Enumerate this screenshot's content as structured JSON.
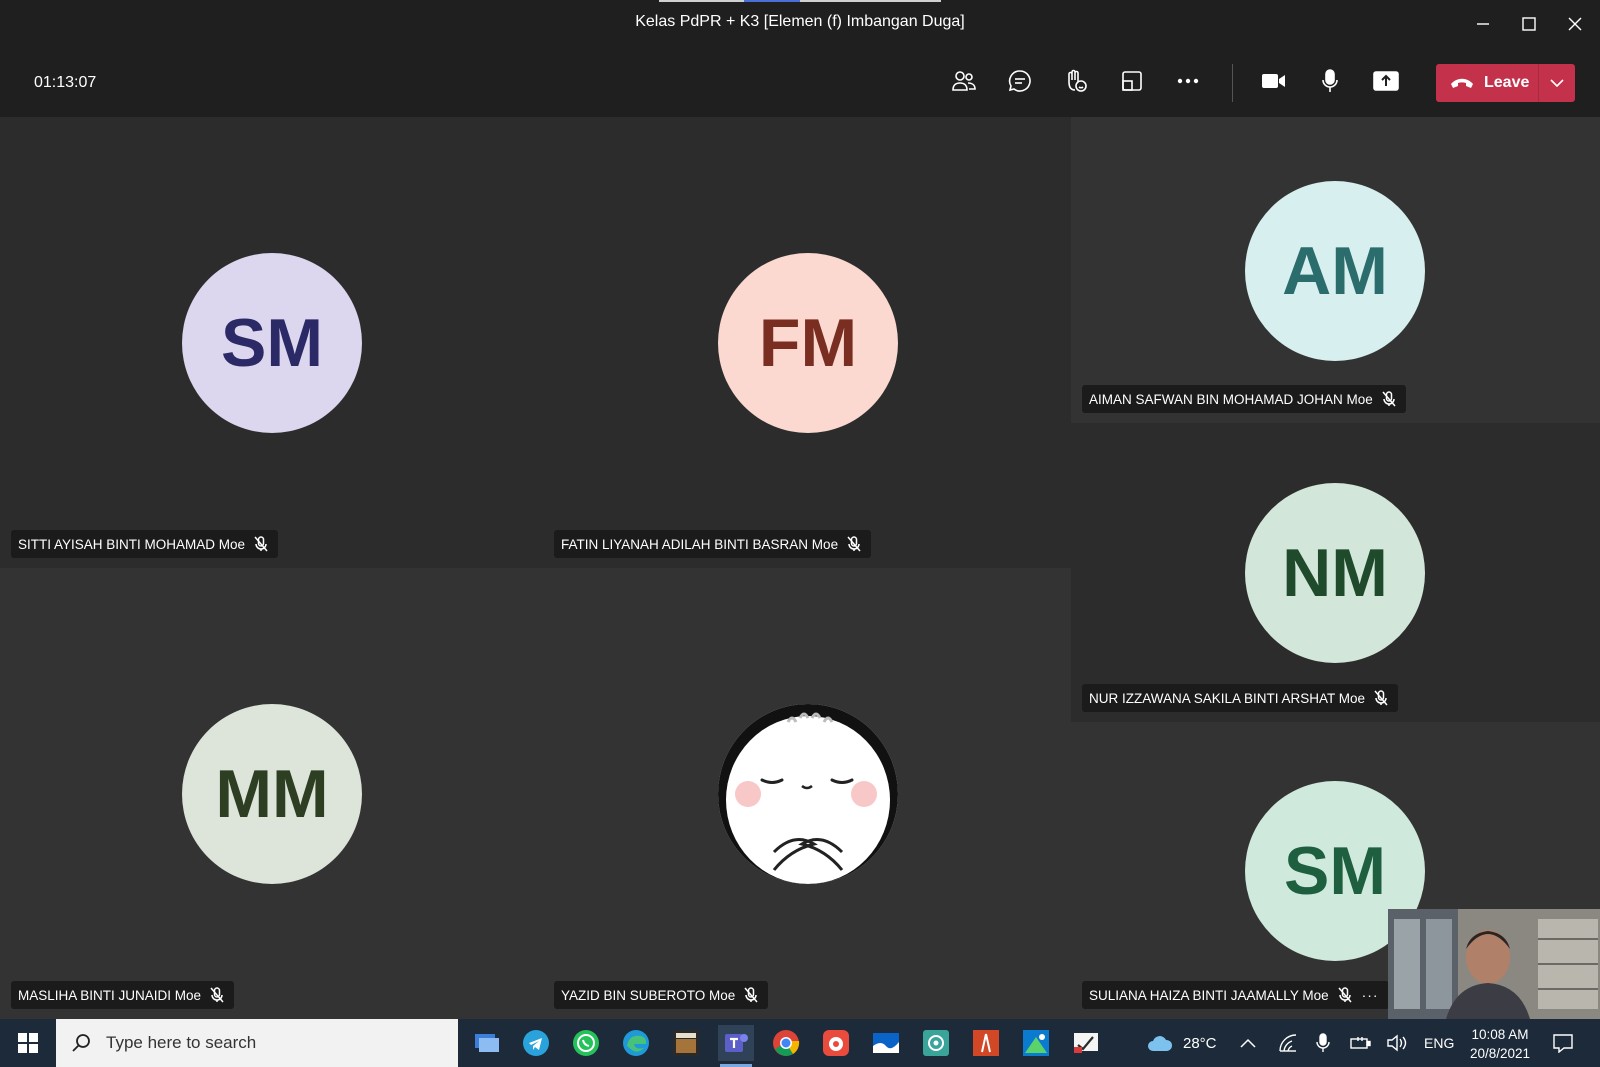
{
  "window": {
    "title": "Kelas PdPR + K3 [Elemen (f) Imbangan Duga]"
  },
  "meeting": {
    "timer": "01:13:07",
    "leave_label": "Leave",
    "toolbar_icons": [
      "people-icon",
      "chat-icon",
      "raise-hand-icon",
      "rooms-icon",
      "more-icon",
      "camera-icon",
      "microphone-icon",
      "share-icon"
    ]
  },
  "participants": [
    {
      "initials": "SM",
      "name": "SITTI AYISAH BINTI MOHAMAD Moe",
      "muted": true,
      "avatar_bg": "#dcd6ee",
      "initials_color": "#2b2a66"
    },
    {
      "initials": "FM",
      "name": "FATIN LIYANAH ADILAH BINTI BASRAN Moe",
      "muted": true,
      "avatar_bg": "#fbd9d1",
      "initials_color": "#7a2e22"
    },
    {
      "initials": "AM",
      "name": "AIMAN SAFWAN BIN MOHAMAD JOHAN Moe",
      "muted": true,
      "avatar_bg": "#d8efef",
      "initials_color": "#2a6d6c"
    },
    {
      "initials": "NM",
      "name": "NUR IZZAWANA SAKILA BINTI ARSHAT Moe",
      "muted": true,
      "avatar_bg": "#d3e6da",
      "initials_color": "#1f4b2c"
    },
    {
      "initials": "MM",
      "name": "MASLIHA BINTI JUNAIDI Moe",
      "muted": true,
      "avatar_bg": "#dde4d9",
      "initials_color": "#2e3e23"
    },
    {
      "initials": "",
      "name": "YAZID BIN SUBEROTO Moe",
      "muted": true,
      "avatar_bg": "#ffffff",
      "initials_color": "#000000",
      "photo": "cartoon-avatar"
    },
    {
      "initials": "SM",
      "name": "SULIANA HAIZA BINTI JAAMALLY Moe",
      "muted": true,
      "avatar_bg": "#cfe9dd",
      "initials_color": "#1e5f40",
      "more": "···"
    }
  ],
  "taskbar": {
    "search_placeholder": "Type here to search",
    "weather": "28°C",
    "language": "ENG",
    "time": "10:08 AM",
    "date": "20/8/2021",
    "apps": [
      "desktop-app-icon",
      "telegram-icon",
      "whatsapp-icon",
      "edge-icon",
      "game-app-icon",
      "teams-icon",
      "chrome-icon",
      "recorder-app-icon",
      "mail-app-icon",
      "settings-app-icon",
      "office-app-icon",
      "xbox-app-icon",
      "video-editor-icon"
    ]
  },
  "colors": {
    "leave": "#c4314b",
    "taskbar": "#1c2a39",
    "stage": "#292929"
  }
}
